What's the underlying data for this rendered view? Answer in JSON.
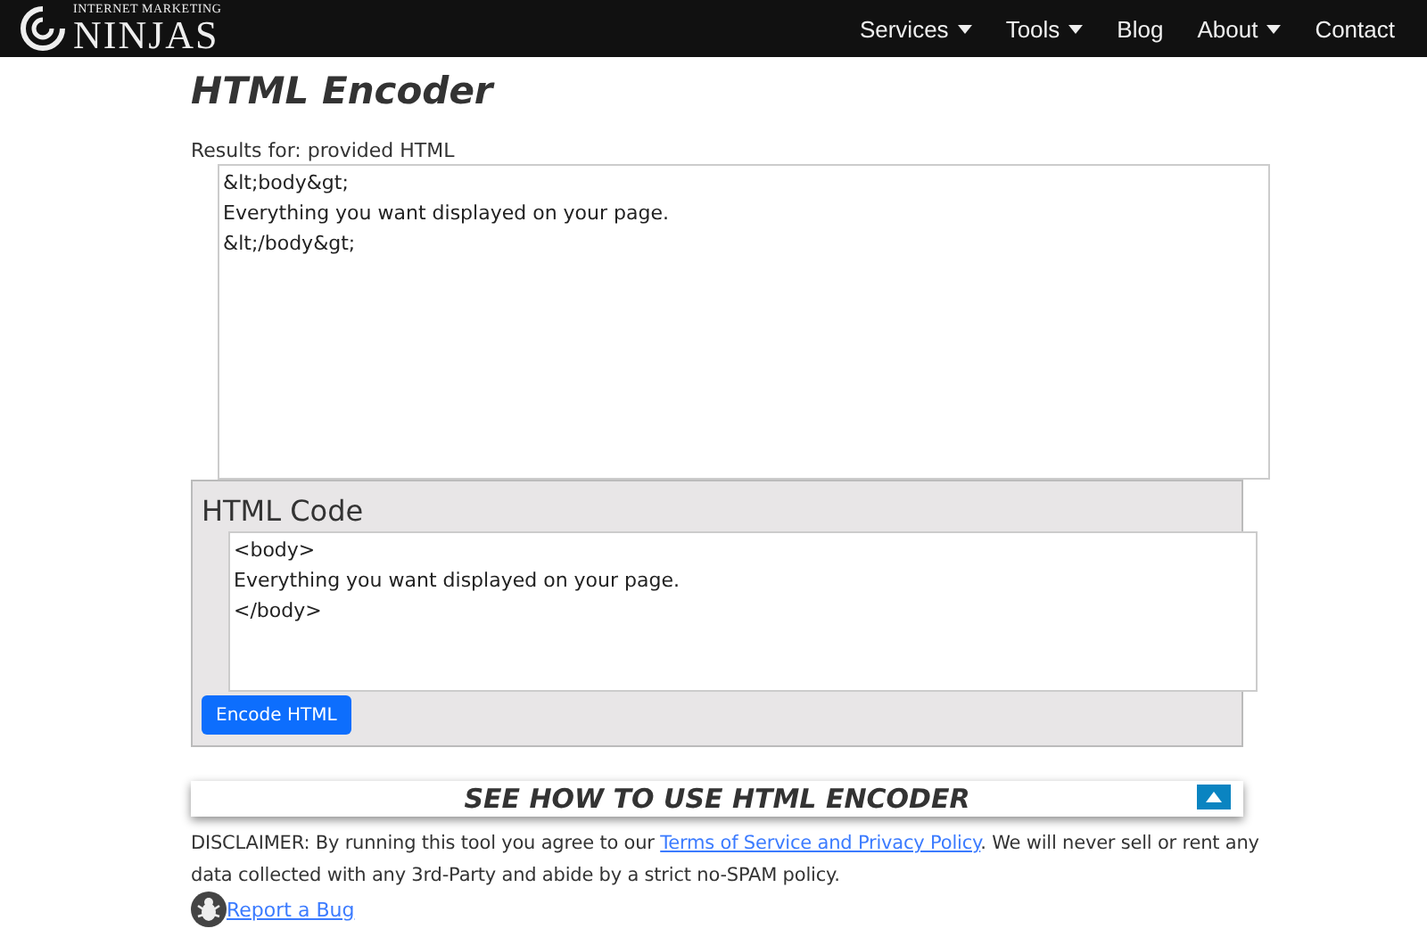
{
  "logo": {
    "tagline": "INTERNET MARKETING",
    "name": "NINJAS"
  },
  "nav": [
    {
      "label": "Services",
      "dropdown": true
    },
    {
      "label": "Tools",
      "dropdown": true
    },
    {
      "label": "Blog",
      "dropdown": false
    },
    {
      "label": "About",
      "dropdown": true
    },
    {
      "label": "Contact",
      "dropdown": false
    }
  ],
  "title": "HTML Encoder",
  "results": {
    "label": "Results for: provided HTML",
    "lines": [
      "&lt;body&gt;",
      "Everything you want displayed on your page.",
      "&lt;/body&gt;"
    ]
  },
  "input_panel": {
    "heading": "HTML Code",
    "lines": [
      "<body>",
      "Everything you want displayed on your page.",
      "</body>"
    ],
    "button": "Encode HTML"
  },
  "howto": {
    "title": "SEE HOW TO USE HTML ENCODER",
    "expanded": false
  },
  "disclaimer": {
    "before": "DISCLAIMER: By running this tool you agree to our ",
    "link": "Terms of Service and Privacy Policy",
    "after": ". We will never sell or rent any data collected with any 3rd-Party and abide by a strict no-SPAM policy."
  },
  "report_link": "Report a Bug"
}
